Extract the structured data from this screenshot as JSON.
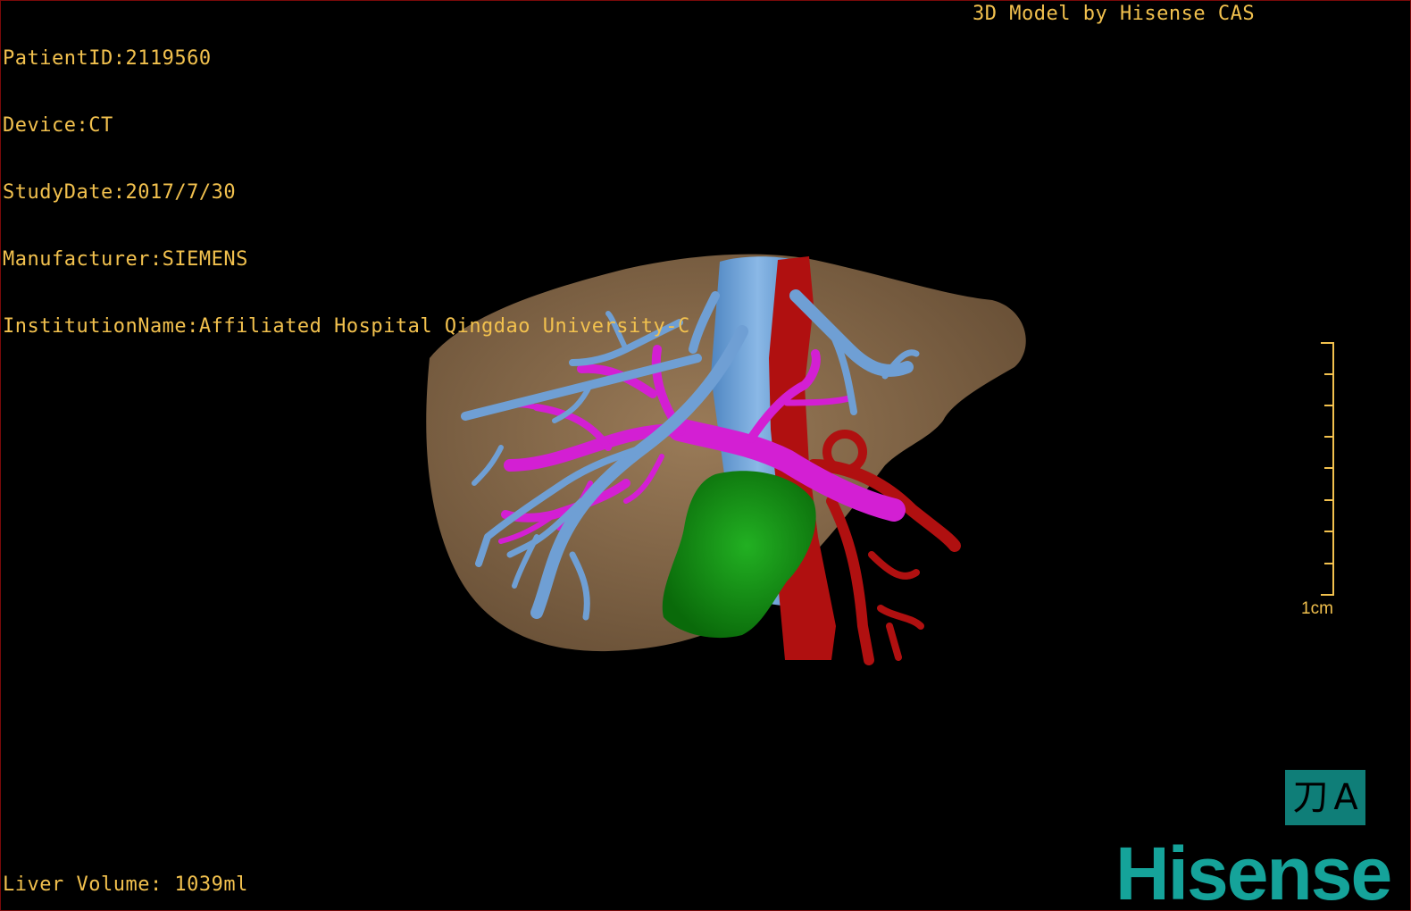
{
  "patient_info": {
    "patient_id": "PatientID:2119560",
    "device": "Device:CT",
    "study_date": "StudyDate:2017/7/30",
    "manufacturer": "Manufacturer:SIEMENS",
    "institution": "InstitutionName:Affiliated Hospital Qingdao University-C"
  },
  "credit": "3D Model by Hisense CAS",
  "liver_volume": "Liver Volume: 1039ml",
  "scale": {
    "label": "1cm"
  },
  "orientation": {
    "left_glyph": "刀",
    "right_glyph": "A"
  },
  "brand": "Hisense",
  "colors": {
    "overlay_text": "#f2c14e",
    "liver": "#8b6e4f",
    "hepatic_vein": "#6f9fd4",
    "portal_vein": "#d31fd3",
    "artery": "#b01010",
    "gallbladder": "#109010",
    "brand": "#15a39a"
  },
  "model_parts": [
    "liver",
    "hepatic-vein",
    "portal-vein",
    "artery",
    "gallbladder"
  ]
}
